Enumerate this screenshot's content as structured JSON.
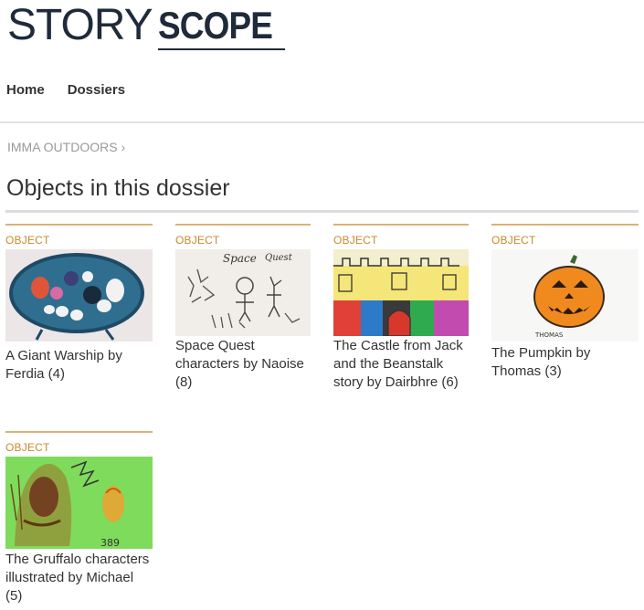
{
  "logo": {
    "part1": "STORY",
    "part2": "SCOPE"
  },
  "nav": {
    "home": "Home",
    "dossiers": "Dossiers"
  },
  "breadcrumb": {
    "label": "IMMA OUTDOORS",
    "separator": "›"
  },
  "page_title": "Objects in this dossier",
  "objects": [
    {
      "type": "OBJECT",
      "title": "A Giant Warship by Ferdia (4)",
      "image": "drawing of a blue giant warship"
    },
    {
      "type": "OBJECT",
      "title": "Space Quest characters by Naoise (8)",
      "image": "pencil drawing of space quest characters"
    },
    {
      "type": "OBJECT",
      "title": "The Castle from Jack and the Beanstalk story by Dairbhre (6)",
      "image": "colourful drawing of a castle"
    },
    {
      "type": "OBJECT",
      "title": "The Pumpkin by Thomas (3)",
      "image": "drawing of an orange pumpkin"
    },
    {
      "type": "OBJECT",
      "title": "The Gruffalo characters illustrated by Michael (5)",
      "image": "drawing of gruffalo characters on green paper"
    }
  ]
}
